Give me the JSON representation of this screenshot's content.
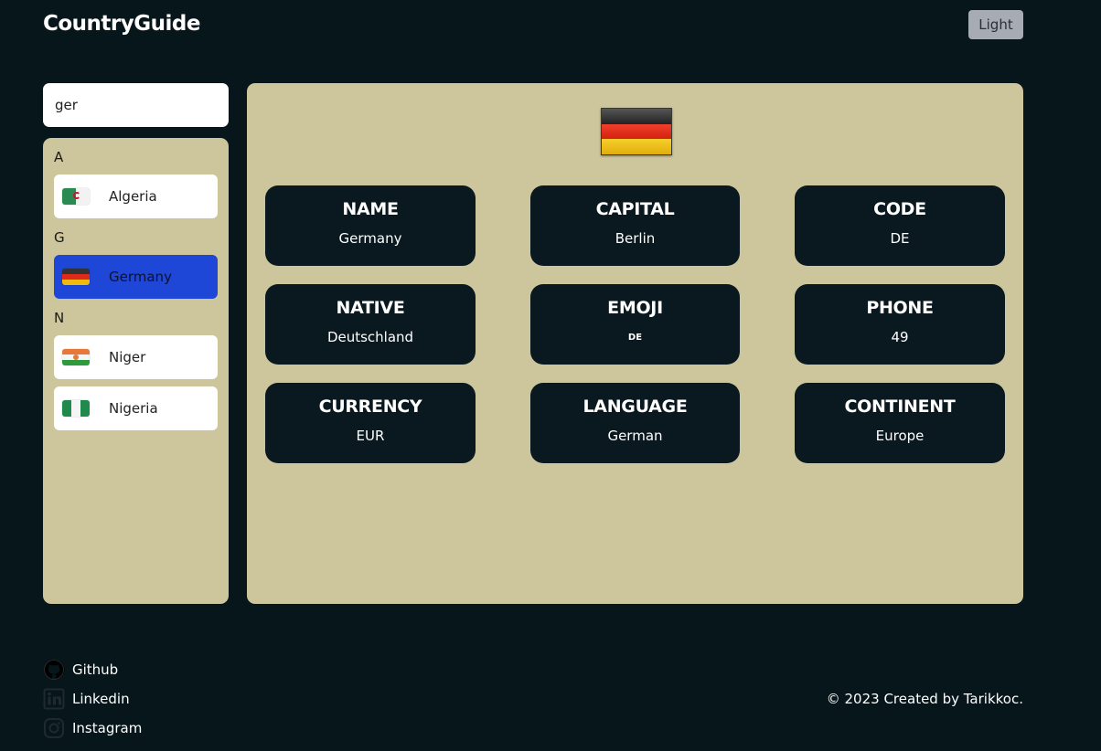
{
  "header": {
    "brand": "CountryGuide",
    "theme_button": "Light"
  },
  "search": {
    "value": "ger",
    "placeholder": ""
  },
  "sidebar": {
    "groups": [
      {
        "letter": "A",
        "countries": [
          {
            "name": "Algeria",
            "flag": "algeria-flag-icon"
          }
        ]
      },
      {
        "letter": "G",
        "countries": [
          {
            "name": "Germany",
            "flag": "germany-flag-icon",
            "selected": true
          }
        ]
      },
      {
        "letter": "N",
        "countries": [
          {
            "name": "Niger",
            "flag": "niger-flag-icon"
          },
          {
            "name": "Nigeria",
            "flag": "nigeria-flag-icon"
          }
        ]
      }
    ]
  },
  "detail": {
    "flag": "germany-flag-icon",
    "cards": [
      {
        "title": "NAME",
        "value": "Germany"
      },
      {
        "title": "CAPITAL",
        "value": "Berlin"
      },
      {
        "title": "CODE",
        "value": "DE"
      },
      {
        "title": "NATIVE",
        "value": "Deutschland"
      },
      {
        "title": "EMOJI",
        "value": "DE"
      },
      {
        "title": "PHONE",
        "value": "49"
      },
      {
        "title": "CURRENCY",
        "value": "EUR"
      },
      {
        "title": "LANGUAGE",
        "value": "German"
      },
      {
        "title": "CONTINENT",
        "value": "Europe"
      }
    ]
  },
  "footer": {
    "links": [
      {
        "label": "Github",
        "icon": "github-icon"
      },
      {
        "label": "Linkedin",
        "icon": "linkedin-icon"
      },
      {
        "label": "Instagram",
        "icon": "instagram-icon"
      }
    ],
    "copyright": "© 2023 Created by Tarikkoc."
  },
  "colors": {
    "background": "#07161b",
    "panel": "#cdc59c",
    "card": "#0a1920",
    "selected": "#1e46d7"
  }
}
